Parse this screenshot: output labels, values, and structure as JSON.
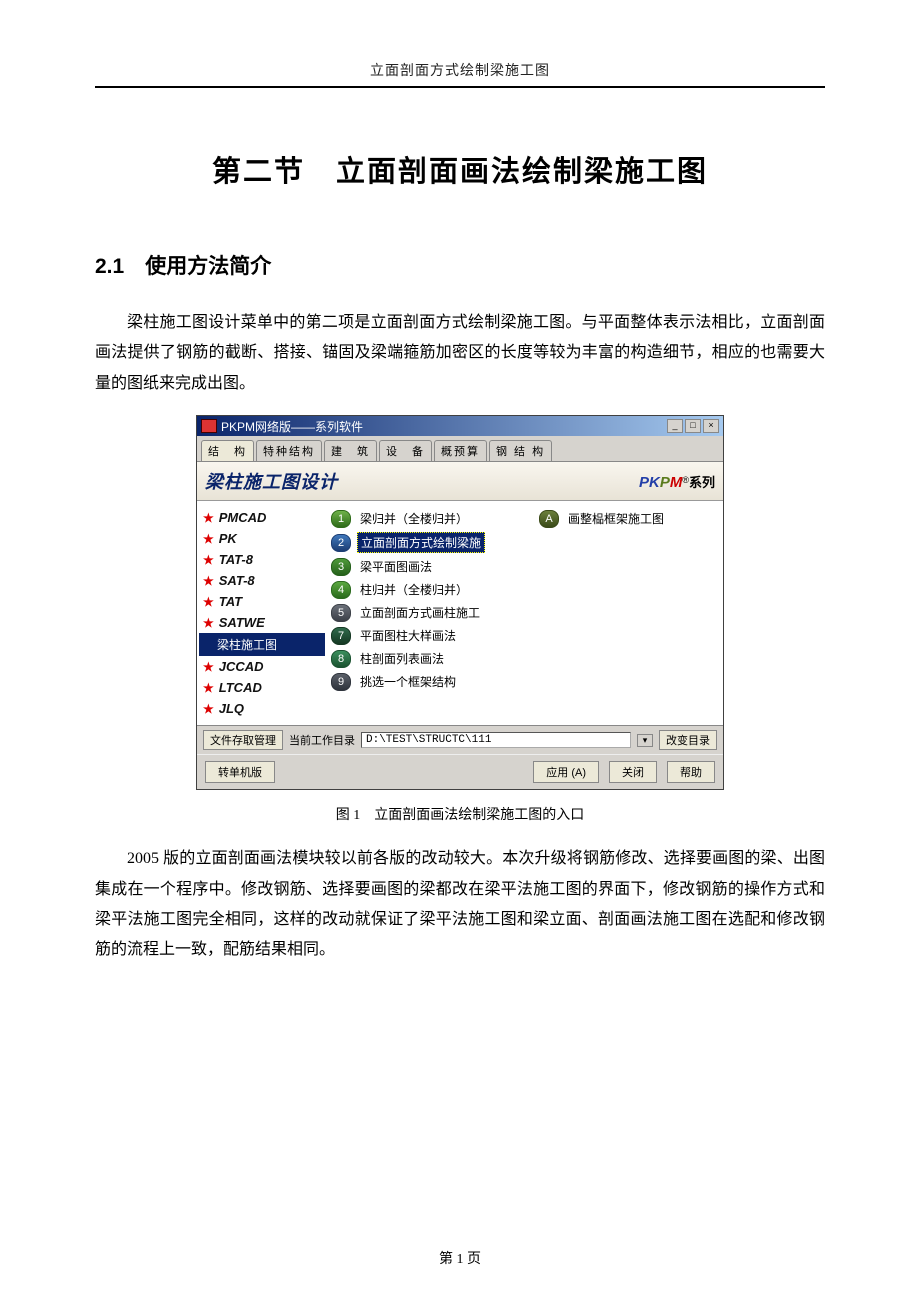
{
  "doc": {
    "running_header": "立面剖面方式绘制梁施工图",
    "title": "第二节　立面剖面画法绘制梁施工图",
    "section_heading": "2.1　使用方法简介",
    "para1": "梁柱施工图设计菜单中的第二项是立面剖面方式绘制梁施工图。与平面整体表示法相比，立面剖面画法提供了钢筋的截断、搭接、锚固及梁端箍筋加密区的长度等较为丰富的构造细节，相应的也需要大量的图纸来完成出图。",
    "caption": "图 1　立面剖面画法绘制梁施工图的入口",
    "para2": "2005 版的立面剖面画法模块较以前各版的改动较大。本次升级将钢筋修改、选择要画图的梁、出图集成在一个程序中。修改钢筋、选择要画图的梁都改在梁平法施工图的界面下，修改钢筋的操作方式和梁平法施工图完全相同，这样的改动就保证了梁平法施工图和梁立面、剖面画法施工图在选配和修改钢筋的流程上一致，配筋结果相同。",
    "page_number": "第 1 页"
  },
  "win": {
    "title": "PKPM网络版——系列软件",
    "tabs": [
      "结　构",
      "特种结构",
      "建　筑",
      "设　备",
      "概预算",
      "钢 结 构"
    ],
    "banner_title": "梁柱施工图设计",
    "brand": {
      "p1": "PK",
      "p2": "P",
      "p3": "M",
      "reg": "®",
      "series": "系列"
    },
    "sidebar": [
      {
        "label": "PMCAD",
        "star": true
      },
      {
        "label": "PK",
        "star": true
      },
      {
        "label": "TAT-8",
        "star": true
      },
      {
        "label": "SAT-8",
        "star": true
      },
      {
        "label": "TAT",
        "star": true
      },
      {
        "label": "SATWE",
        "star": true
      },
      {
        "label": "梁柱施工图",
        "selected": true
      },
      {
        "label": "JCCAD",
        "star": true
      },
      {
        "label": "LTCAD",
        "star": true
      },
      {
        "label": "JLQ",
        "star": true
      }
    ],
    "items": [
      {
        "n": "1",
        "label": "梁归并（全楼归并）"
      },
      {
        "n": "2",
        "label": "立面剖面方式绘制梁施",
        "selected": true
      },
      {
        "n": "3",
        "label": "梁平面图画法"
      },
      {
        "n": "4",
        "label": "柱归并（全楼归并）"
      },
      {
        "n": "5",
        "label": "立面剖面方式画柱施工"
      },
      {
        "n": "7",
        "label": "平面图柱大样画法"
      },
      {
        "n": "8",
        "label": "柱剖面列表画法"
      },
      {
        "n": "9",
        "label": "挑选一个框架结构"
      }
    ],
    "right_item": {
      "n": "A",
      "label": "画整榀框架施工图"
    },
    "footer": {
      "file_btn": "文件存取管理",
      "work_dir_label": "当前工作目录",
      "work_dir": "D:\\TEST\\STRUCTC\\111",
      "change_dir": "改变目录",
      "single_btn": "转单机版",
      "apply_btn": "应用 (A)",
      "close_btn": "关闭",
      "help_btn": "帮助"
    }
  }
}
